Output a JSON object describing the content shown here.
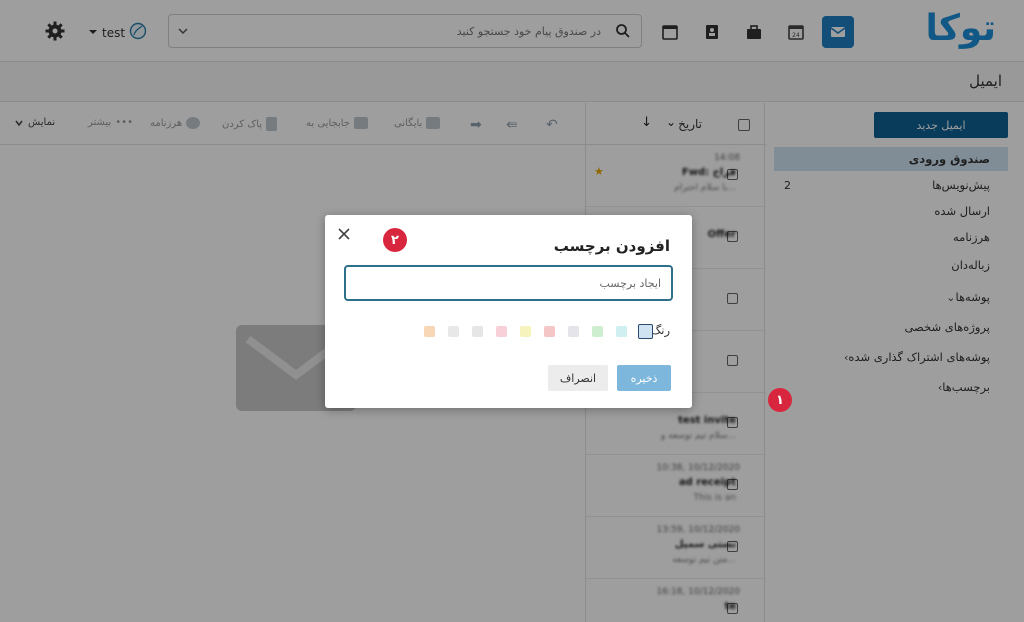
{
  "app": {
    "logo_text": "توکا",
    "user_name": "test",
    "page_title": "ایمیل"
  },
  "search": {
    "placeholder": "در صندوق پیام خود جستجو کنید"
  },
  "sidebar": {
    "new_email_label": "ایمیل جدید",
    "folders": [
      {
        "label": "صندوق ورودی",
        "count": ""
      },
      {
        "label": "پیش‌نویس‌ها",
        "count": "2"
      },
      {
        "label": "ارسال شده",
        "count": ""
      },
      {
        "label": "هرزنامه",
        "count": ""
      },
      {
        "label": "زباله‌دان",
        "count": ""
      },
      {
        "label": "پوشه‌ها",
        "count": ""
      },
      {
        "label": "پروژه‌های شخصی",
        "count": ""
      },
      {
        "label": "پوشه‌های اشتراک گذاری شده",
        "count": ""
      },
      {
        "label": "برچسب‌ها",
        "count": ""
      }
    ]
  },
  "message_list": {
    "sort_label": "تاریخ",
    "messages": [
      {
        "time": "14:08",
        "from": "Fwd: فراخ",
        "subject": "با سلام احترام..."
      },
      {
        "time": "",
        "from": "Offer",
        "subject": ""
      },
      {
        "time": "",
        "from": "",
        "subject": ""
      },
      {
        "time": "",
        "from": "",
        "subject": ""
      },
      {
        "time": "",
        "from": "test invite",
        "subject": "سلام تیم توسعه و..."
      },
      {
        "time": "10:38, 10/12/2020",
        "from": "ad receipt",
        "subject": "This is an"
      },
      {
        "time": "13:59, 10/12/2020",
        "from": "تستی سمپل",
        "subject": "متن تیم توسعه..."
      },
      {
        "time": "16:18, 10/12/2020",
        "from": "te",
        "subject": ""
      }
    ]
  },
  "reader_toolbar": {
    "view_label": "نمایش",
    "more_label": "بیشتر",
    "spam_label": "هرزنامه",
    "delete_label": "پاک کردن",
    "move_label": "جابجایی به",
    "archive_label": "بایگانی"
  },
  "markers": {
    "one": "۱",
    "two": "۲"
  },
  "dialog": {
    "title": "افزودن برچسب",
    "input_placeholder": "ایجاد برچسب",
    "color_label": "رنگ",
    "save_label": "ذخیره",
    "cancel_label": "انصراف",
    "colors": [
      "#cfe3f2",
      "#cfeff0",
      "#cdefcf",
      "#e4e4ea",
      "#f5c6c6",
      "#f6f3bd",
      "#f7d0d8",
      "#e6e6e6",
      "#e8e8e8",
      "#f8d7b6"
    ],
    "selected_color": "#cfe3f2"
  }
}
